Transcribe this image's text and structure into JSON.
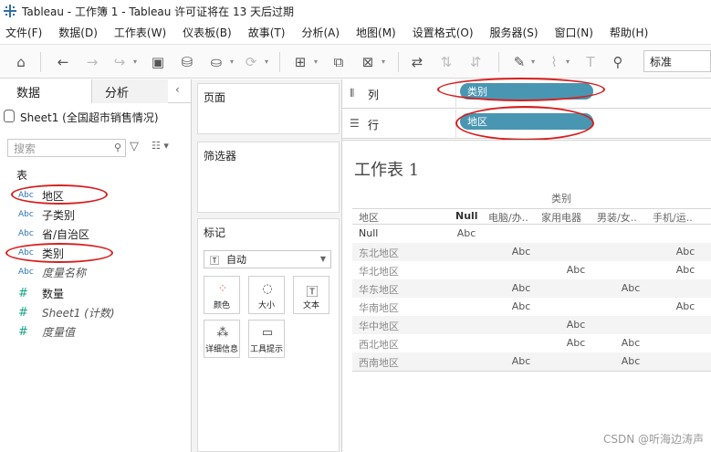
{
  "window": {
    "title": "Tableau - 工作簿 1 - Tableau 许可证将在 13 天后过期"
  },
  "menu": [
    "文件(F)",
    "数据(D)",
    "工作表(W)",
    "仪表板(B)",
    "故事(T)",
    "分析(A)",
    "地图(M)",
    "设置格式(O)",
    "服务器(S)",
    "窗口(N)",
    "帮助(H)"
  ],
  "toolbar": {
    "fit_select": "标准"
  },
  "data_pane": {
    "tabs": [
      "数据",
      "分析"
    ],
    "datasource": "Sheet1 (全国超市销售情况)",
    "search_placeholder": "搜索",
    "section": "表",
    "dimensions": [
      {
        "type": "Abc",
        "label": "地区",
        "highlighted": true
      },
      {
        "type": "Abc",
        "label": "子类别",
        "highlighted": false
      },
      {
        "type": "Abc",
        "label": "省/自治区",
        "highlighted": false
      },
      {
        "type": "Abc",
        "label": "类别",
        "highlighted": true
      },
      {
        "type": "Abc",
        "label": "度量名称",
        "highlighted": false
      }
    ],
    "measures": [
      {
        "type": "#",
        "label": "数量"
      },
      {
        "type": "#",
        "label": "Sheet1 (计数)"
      },
      {
        "type": "#",
        "label": "度量值"
      }
    ]
  },
  "shelves": {
    "pages": "页面",
    "filters": "筛选器",
    "marks": {
      "title": "标记",
      "type": "自动",
      "buttons": [
        "颜色",
        "大小",
        "文本",
        "详细信息",
        "工具提示"
      ]
    }
  },
  "columns_shelf": {
    "label": "列",
    "pill": "类别"
  },
  "rows_shelf": {
    "label": "行",
    "pill": "地区"
  },
  "view": {
    "title": "工作表 1",
    "column_group": "类别",
    "row_header": "地区",
    "columns": [
      "Null",
      "电脑/办..",
      "家用电器",
      "男装/女..",
      "手机/运.."
    ],
    "rows": [
      {
        "label": "Null",
        "cells": [
          "Abc",
          "",
          "",
          "",
          ""
        ]
      },
      {
        "label": "东北地区",
        "cells": [
          "",
          "Abc",
          "",
          "",
          "Abc"
        ]
      },
      {
        "label": "华北地区",
        "cells": [
          "",
          "",
          "Abc",
          "",
          "Abc"
        ]
      },
      {
        "label": "华东地区",
        "cells": [
          "",
          "Abc",
          "",
          "Abc",
          ""
        ]
      },
      {
        "label": "华南地区",
        "cells": [
          "",
          "Abc",
          "",
          "",
          "Abc"
        ]
      },
      {
        "label": "华中地区",
        "cells": [
          "",
          "",
          "Abc",
          "",
          ""
        ]
      },
      {
        "label": "西北地区",
        "cells": [
          "",
          "",
          "Abc",
          "Abc",
          ""
        ]
      },
      {
        "label": "西南地区",
        "cells": [
          "",
          "Abc",
          "",
          "Abc",
          ""
        ]
      }
    ]
  },
  "watermark": "CSDN @听海边涛声",
  "colors": {
    "pill": "#4996b2",
    "annotation": "#d81e1e"
  }
}
